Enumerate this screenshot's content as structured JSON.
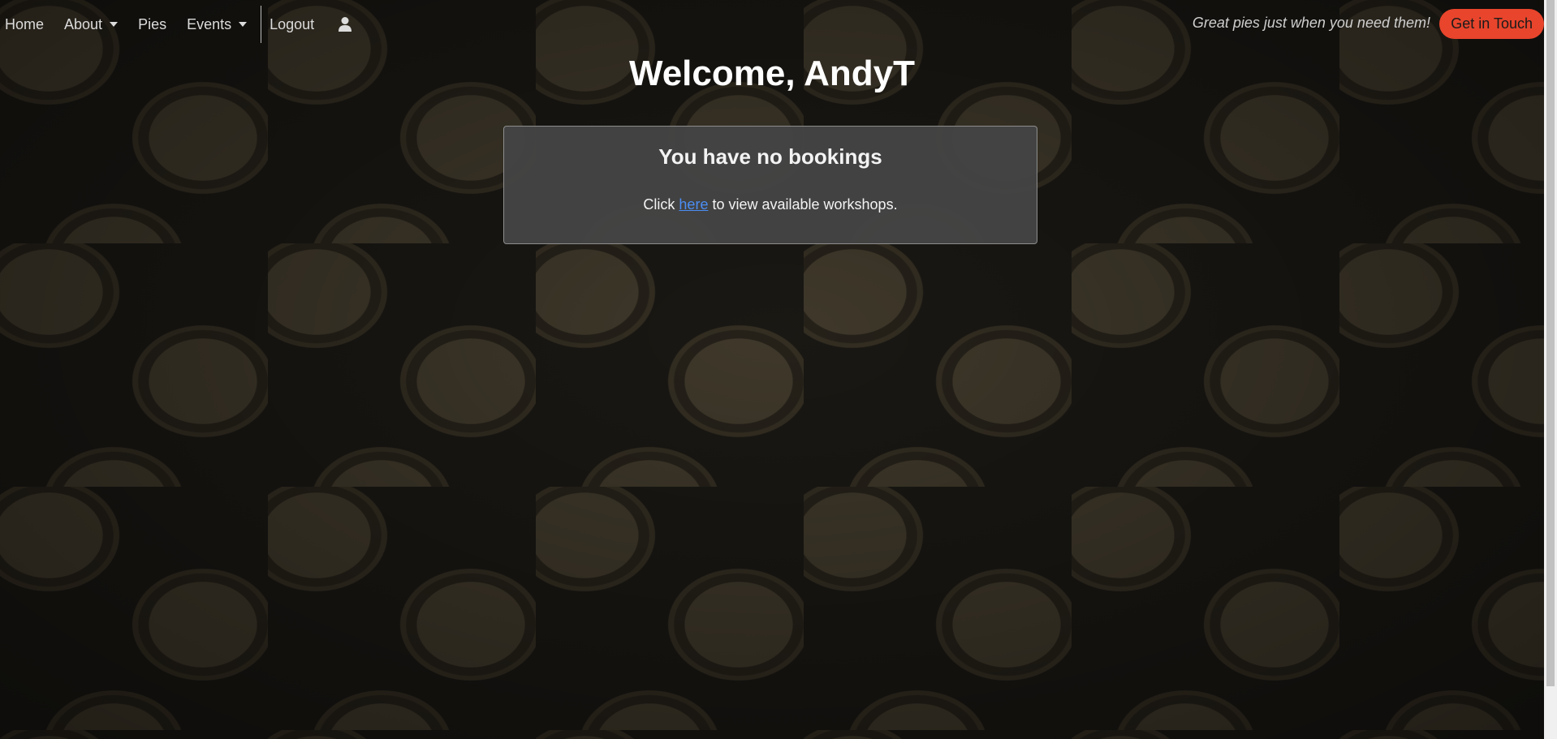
{
  "nav": {
    "items": [
      {
        "label": "Home"
      },
      {
        "label": "About"
      },
      {
        "label": "Pies"
      },
      {
        "label": "Events"
      },
      {
        "label": "Logout"
      }
    ],
    "tagline": "Great pies just when you need them!",
    "cta_label": "Get in Touch"
  },
  "main": {
    "welcome": "Welcome, AndyT",
    "card_title": "You have no bookings",
    "text_before": "Click ",
    "link_text": "here",
    "text_after": " to view available workshops."
  },
  "colors": {
    "accent": "#e8452c",
    "link": "#4b8ef5",
    "card_bg": "#444444"
  },
  "icons": [
    "user-icon",
    "dropdown-caret-icon"
  ]
}
